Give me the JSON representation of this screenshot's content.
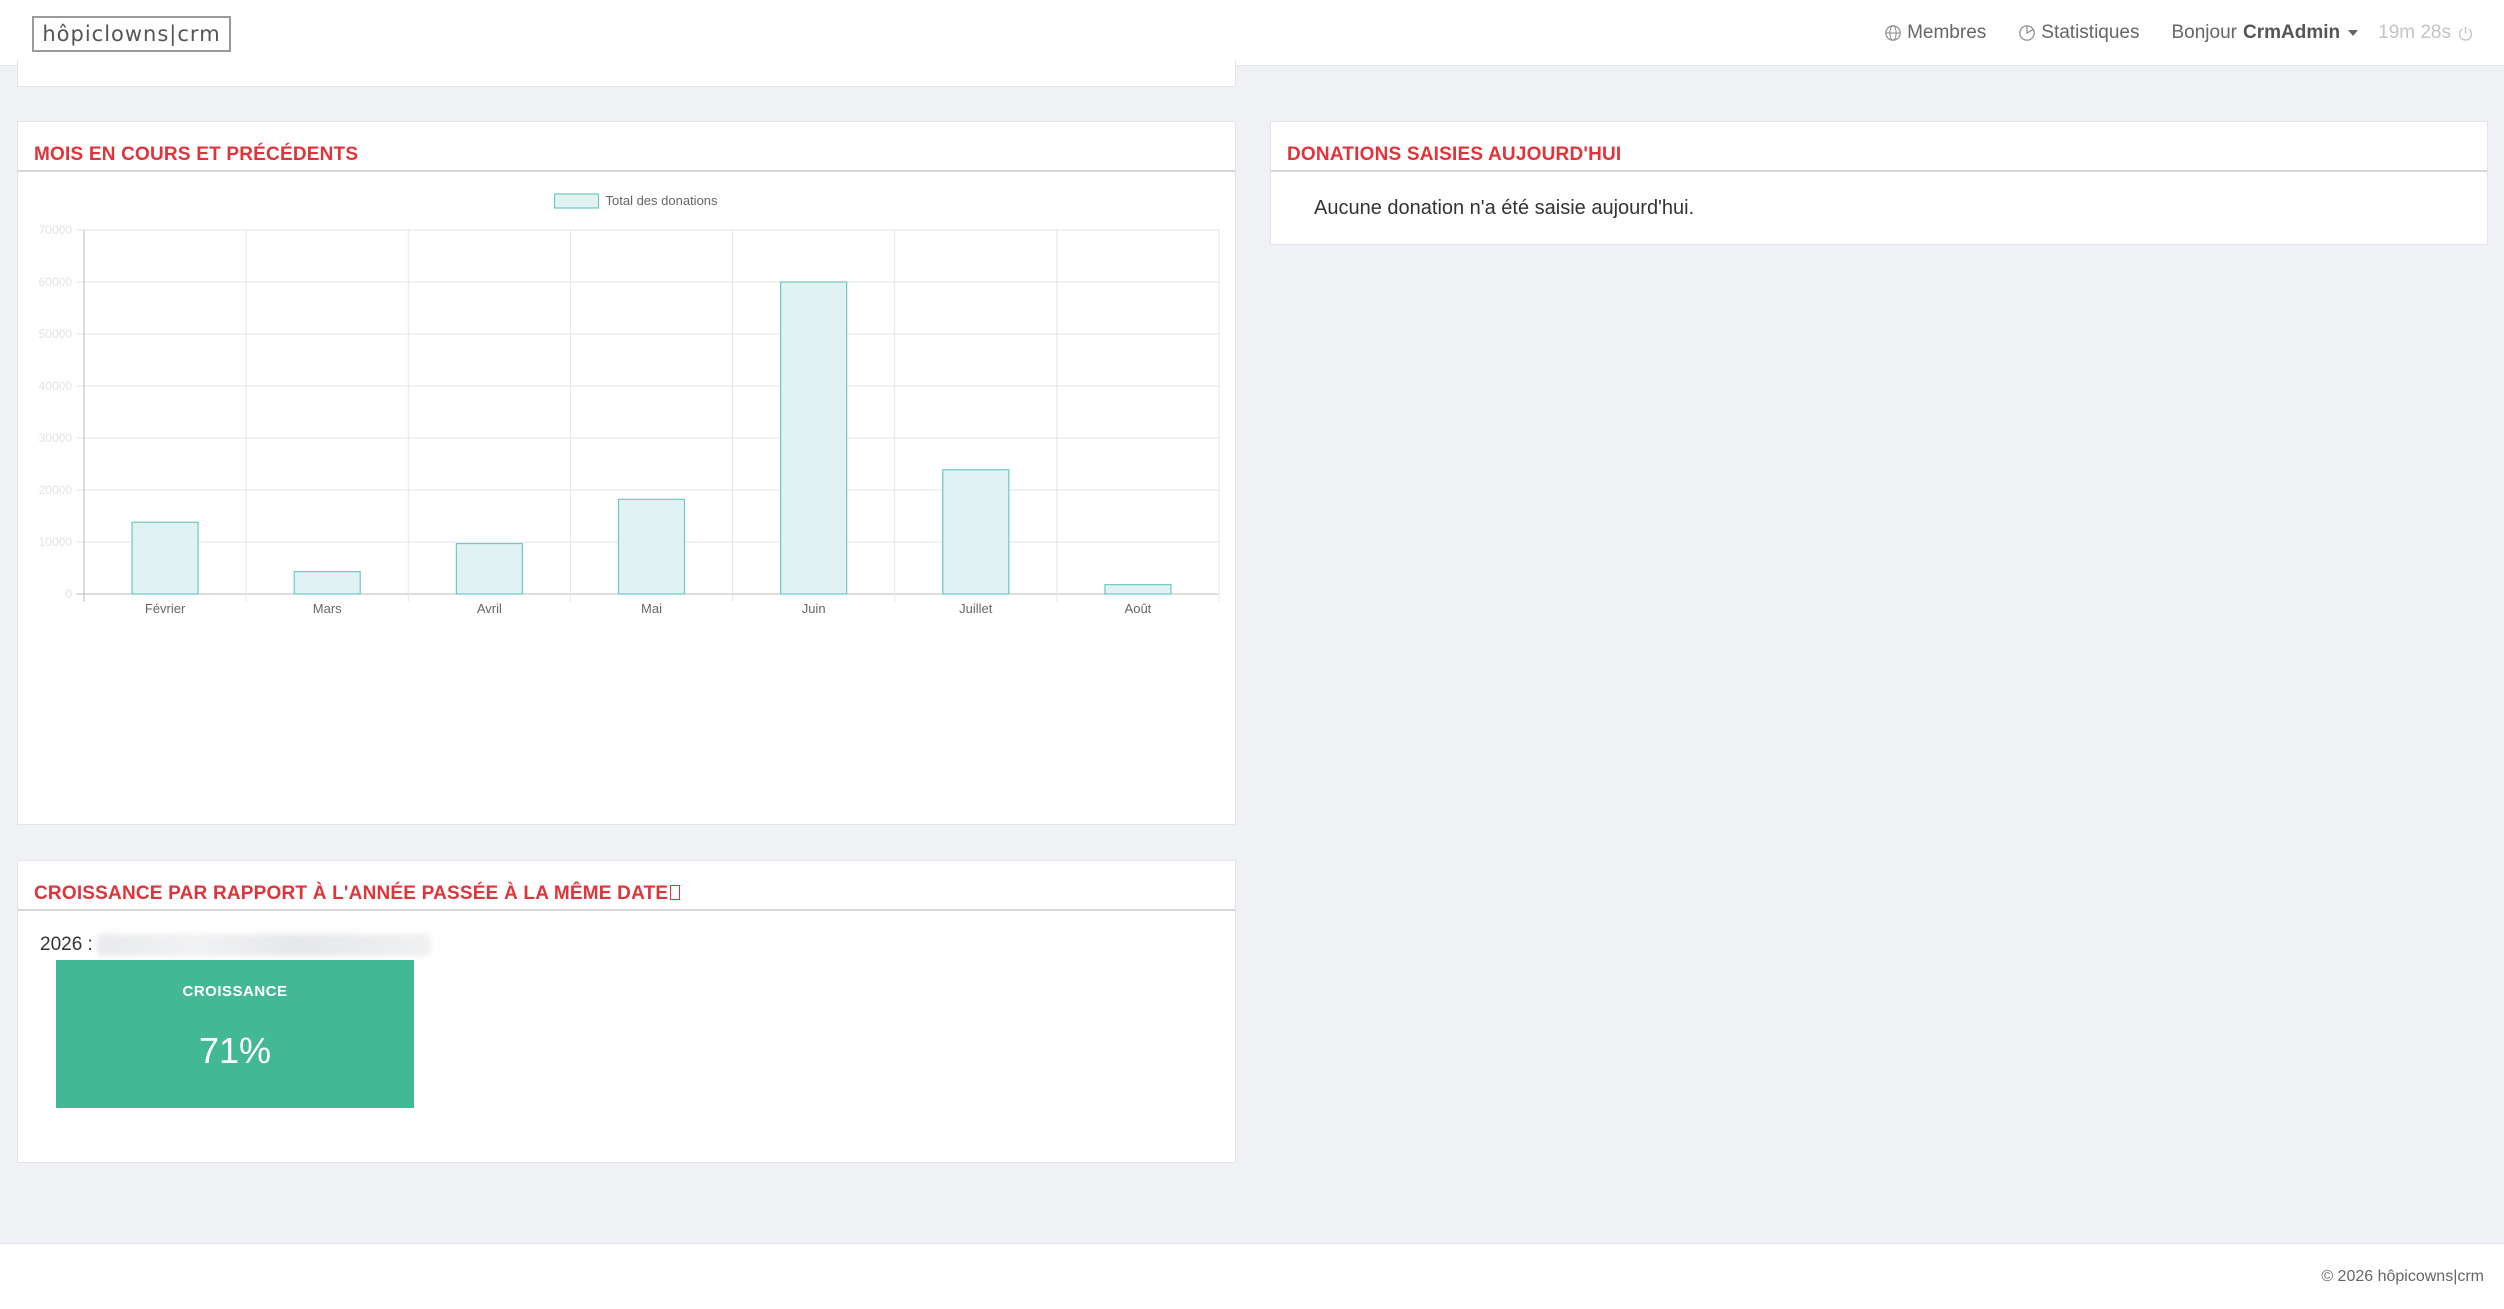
{
  "navbar": {
    "brand": "hôpiclowns|crm",
    "members_label": "Membres",
    "stats_label": "Statistiques",
    "greeting": "Bonjour",
    "user_name": "CrmAdmin",
    "session_timer": "19m 28s"
  },
  "panels": {
    "chart_title": "MOIS EN COURS ET PRÉCÉDENTS",
    "today_title": "DONATIONS SAISIES AUJOURD'HUI",
    "today_empty": "Aucune donation n'a été saisie aujourd'hui.",
    "growth_title": "CROISSANCE PAR RAPPORT À L'ANNÉE PASSÉE À LA MÊME DATE",
    "growth_year_label": "2026 :",
    "growth_card_title": "CROISSANCE",
    "growth_card_value": "71%"
  },
  "colors": {
    "accent_red": "#e0343a",
    "growth_green": "#42b894",
    "bar_fill": "#e0f3f2",
    "bar_stroke": "#6cc8c5"
  },
  "chart_data": {
    "type": "bar",
    "categories": [
      "Février",
      "Mars",
      "Avril",
      "Mai",
      "Juin",
      "Juillet",
      "Août"
    ],
    "series": [
      {
        "name": "Total des donations",
        "values": [
          13800,
          4300,
          9700,
          18200,
          60000,
          23900,
          1800
        ]
      }
    ],
    "ylim": [
      0,
      70000
    ],
    "y_ticks": [
      0,
      10000,
      20000,
      30000,
      40000,
      50000,
      60000,
      70000
    ],
    "legend": "top-center",
    "grid": true
  },
  "footer": {
    "copyright": "© 2026 hôpicowns|crm"
  }
}
